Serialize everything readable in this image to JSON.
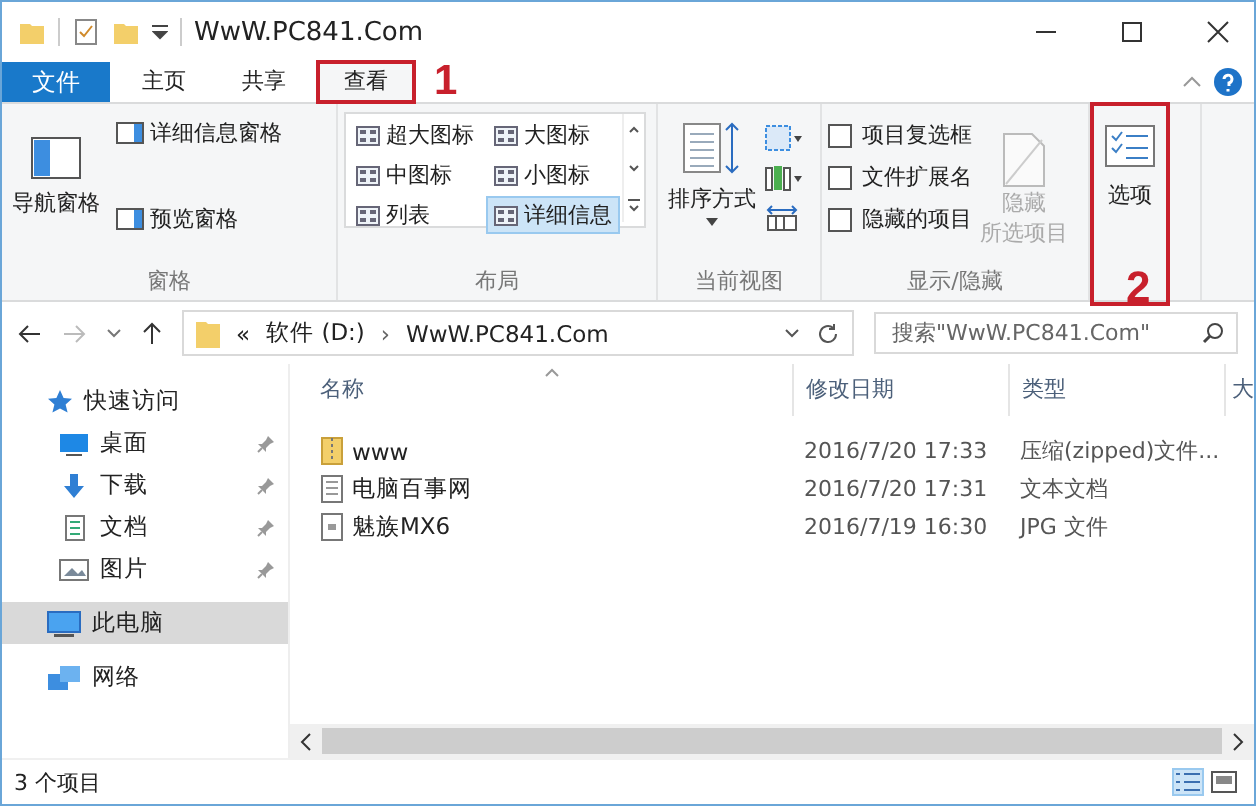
{
  "window": {
    "title": "WwW.PC841.Com"
  },
  "tabs": [
    {
      "label": "文件",
      "kind": "file",
      "selected": false
    },
    {
      "label": "主页",
      "kind": "tab",
      "selected": false
    },
    {
      "label": "共享",
      "kind": "tab",
      "selected": false
    },
    {
      "label": "查看",
      "kind": "tab",
      "selected": true,
      "callout": "1"
    }
  ],
  "ribbon": {
    "panes": {
      "nav_pane": "导航窗格",
      "details_pane": "详细信息窗格",
      "preview_pane": "预览窗格",
      "group": "窗格"
    },
    "layout": {
      "items": [
        {
          "label": "超大图标",
          "selected": false
        },
        {
          "label": "大图标",
          "selected": false
        },
        {
          "label": "中图标",
          "selected": false
        },
        {
          "label": "小图标",
          "selected": false
        },
        {
          "label": "列表",
          "selected": false
        },
        {
          "label": "详细信息",
          "selected": true
        }
      ],
      "group": "布局"
    },
    "current_view": {
      "sort": "排序方式",
      "group": "当前视图"
    },
    "show_hide": {
      "checkboxes": [
        {
          "label": "项目复选框",
          "checked": false
        },
        {
          "label": "文件扩展名",
          "checked": false
        },
        {
          "label": "隐藏的项目",
          "checked": false
        }
      ],
      "hide_selected": [
        "隐藏",
        "所选项目"
      ],
      "group": "显示/隐藏"
    },
    "options": {
      "label": "选项",
      "callout": "2"
    }
  },
  "address": {
    "separator": "›",
    "path": [
      {
        "label": "«"
      },
      {
        "label": "软件 (D:)"
      },
      {
        "label": "WwW.PC841.Com"
      }
    ],
    "search": {
      "placeholder": "搜索\"WwW.PC841.Com\""
    }
  },
  "sidebar": {
    "items": [
      {
        "label": "快速访问",
        "kind": "star",
        "pinned": false,
        "selected": false,
        "children": [
          {
            "label": "桌面",
            "kind": "desktop",
            "pinned": true,
            "selected": false
          },
          {
            "label": "下载",
            "kind": "download",
            "pinned": true,
            "selected": false
          },
          {
            "label": "文档",
            "kind": "document",
            "pinned": true,
            "selected": false
          },
          {
            "label": "图片",
            "kind": "image",
            "pinned": true,
            "selected": false
          }
        ]
      },
      {
        "label": "此电脑",
        "kind": "computer",
        "pinned": false,
        "selected": true
      },
      {
        "label": "网络",
        "kind": "network",
        "pinned": false,
        "selected": false
      }
    ]
  },
  "table": {
    "columns": [
      "名称",
      "修改日期",
      "类型",
      "大"
    ],
    "rows": [
      {
        "kind": "zip",
        "cells": [
          "www",
          "2016/7/20 17:33",
          "压缩(zipped)文件..."
        ]
      },
      {
        "kind": "text",
        "cells": [
          "电脑百事网",
          "2016/7/20 17:31",
          "文本文档"
        ]
      },
      {
        "kind": "image",
        "cells": [
          "魅族MX6",
          "2016/7/19 16:30",
          "JPG 文件"
        ]
      }
    ]
  },
  "status_bar": {
    "count": "3 个项目"
  }
}
